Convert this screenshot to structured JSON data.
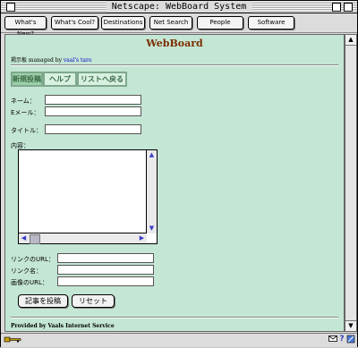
{
  "window": {
    "title": "Netscape: WebBoard System"
  },
  "directory_buttons": [
    {
      "label": "What's New?"
    },
    {
      "label": "What's Cool?"
    },
    {
      "label": "Destinations"
    },
    {
      "label": "Net Search"
    },
    {
      "label": "People"
    },
    {
      "label": "Software"
    }
  ],
  "page": {
    "title": "WebBoard",
    "managed_prefix": "掲示板 managed by ",
    "manager_link": "vaal's taro"
  },
  "tabs": [
    {
      "label": "新規投稿"
    },
    {
      "label": "ヘルプ"
    },
    {
      "label": "リストへ戻る"
    }
  ],
  "form": {
    "name_label": "ネーム：",
    "name_value": "",
    "email_label": "Eメール：",
    "email_value": "",
    "title_label": "タイトル：",
    "title_value": "",
    "content_label": "内容：",
    "content_value": "",
    "link_url_label": "リンクのURL：",
    "link_url_value": "",
    "link_name_label": "リンク名：",
    "link_name_value": "",
    "image_url_label": "画像のURL：",
    "image_url_value": "",
    "submit_label": "記事を投稿",
    "reset_label": "リセット"
  },
  "footer": {
    "text": "Provided by Vaals Internet Service"
  },
  "colors": {
    "page_background": "#c4e6d4",
    "title_color": "#7b2d00",
    "link_color": "#0000c8",
    "tab_text": "#3a6a45"
  },
  "icons": {
    "status_left": "netscape-key-icon",
    "status_right": [
      "mail-icon",
      "help-icon",
      "component-icon"
    ]
  }
}
